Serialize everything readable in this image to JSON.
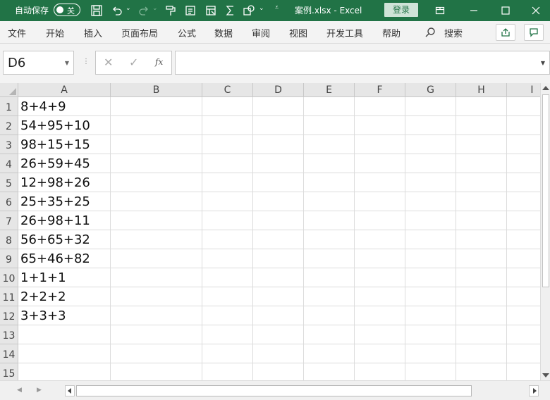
{
  "titlebar": {
    "autosave_label": "自动保存",
    "autosave_state": "关",
    "doc_title": "案例.xlsx  -  Excel",
    "login_label": "登录",
    "bg_color": "#217346"
  },
  "ribbon": {
    "tabs": [
      "文件",
      "开始",
      "插入",
      "页面布局",
      "公式",
      "数据",
      "审阅",
      "视图",
      "开发工具",
      "帮助"
    ],
    "search_label": "搜索"
  },
  "formula_bar": {
    "name_box": "D6",
    "cancel": "✕",
    "enter": "✓",
    "fx": "fx",
    "formula_value": ""
  },
  "grid": {
    "columns": [
      "A",
      "B",
      "C",
      "D",
      "E",
      "F",
      "G",
      "H",
      "I"
    ],
    "rows": [
      "1",
      "2",
      "3",
      "4",
      "5",
      "6",
      "7",
      "8",
      "9",
      "10",
      "11",
      "12",
      "13",
      "14",
      "15"
    ],
    "column_a_values": [
      "8+4+9",
      "54+95+10",
      "98+15+15",
      "26+59+45",
      "12+98+26",
      "25+35+25",
      "26+98+11",
      "56+65+32",
      "65+46+82",
      "1+1+1",
      "2+2+2",
      "3+3+3",
      "",
      "",
      ""
    ]
  }
}
